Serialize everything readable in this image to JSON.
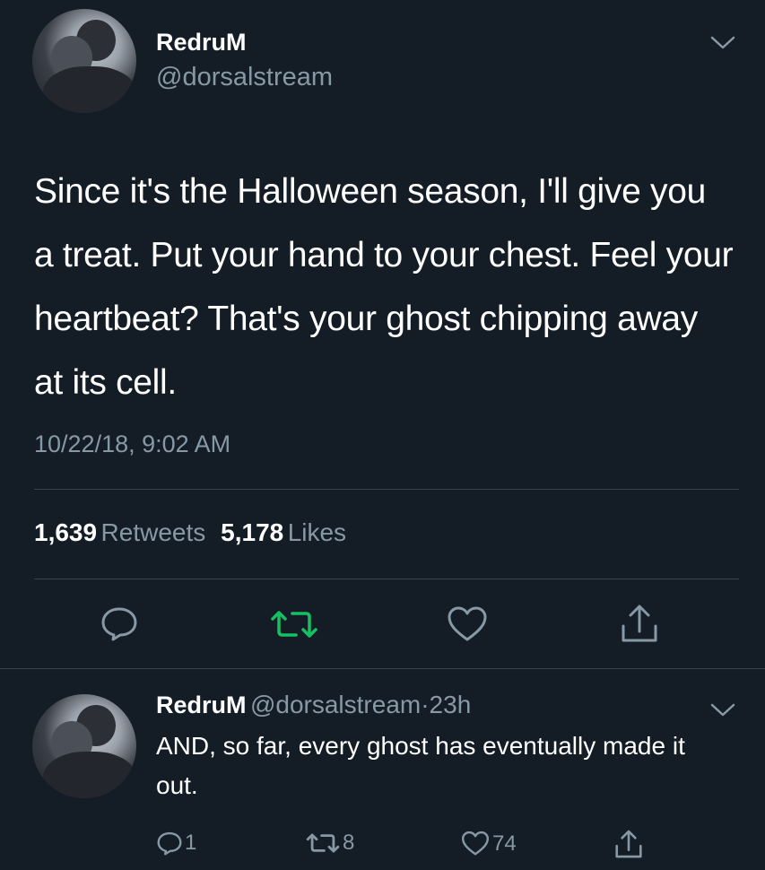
{
  "colors": {
    "background": "#141d26",
    "secondary_text": "#8899a6",
    "divider": "#38444d",
    "retweet_green": "#17bf63"
  },
  "main_tweet": {
    "author_name": "RedruM",
    "author_handle": "@dorsalstream",
    "text": "Since it's the Halloween season, I'll give you a treat. Put your hand to your chest. Feel your heartbeat? That's your ghost chipping away at its cell.",
    "timestamp": "10/22/18, 9:02 AM",
    "retweets_count": "1,639",
    "retweets_label": "Retweets",
    "likes_count": "5,178",
    "likes_label": "Likes",
    "actions": [
      "reply-icon",
      "retweet-icon",
      "like-icon",
      "share-icon"
    ]
  },
  "reply_tweet": {
    "author_name": "RedruM",
    "author_handle": "@dorsalstream",
    "separator": "·",
    "time_ago": "23h",
    "text": "AND, so far, every ghost has eventually made it out.",
    "reply_count": "1",
    "retweet_count": "8",
    "like_count": "74"
  }
}
